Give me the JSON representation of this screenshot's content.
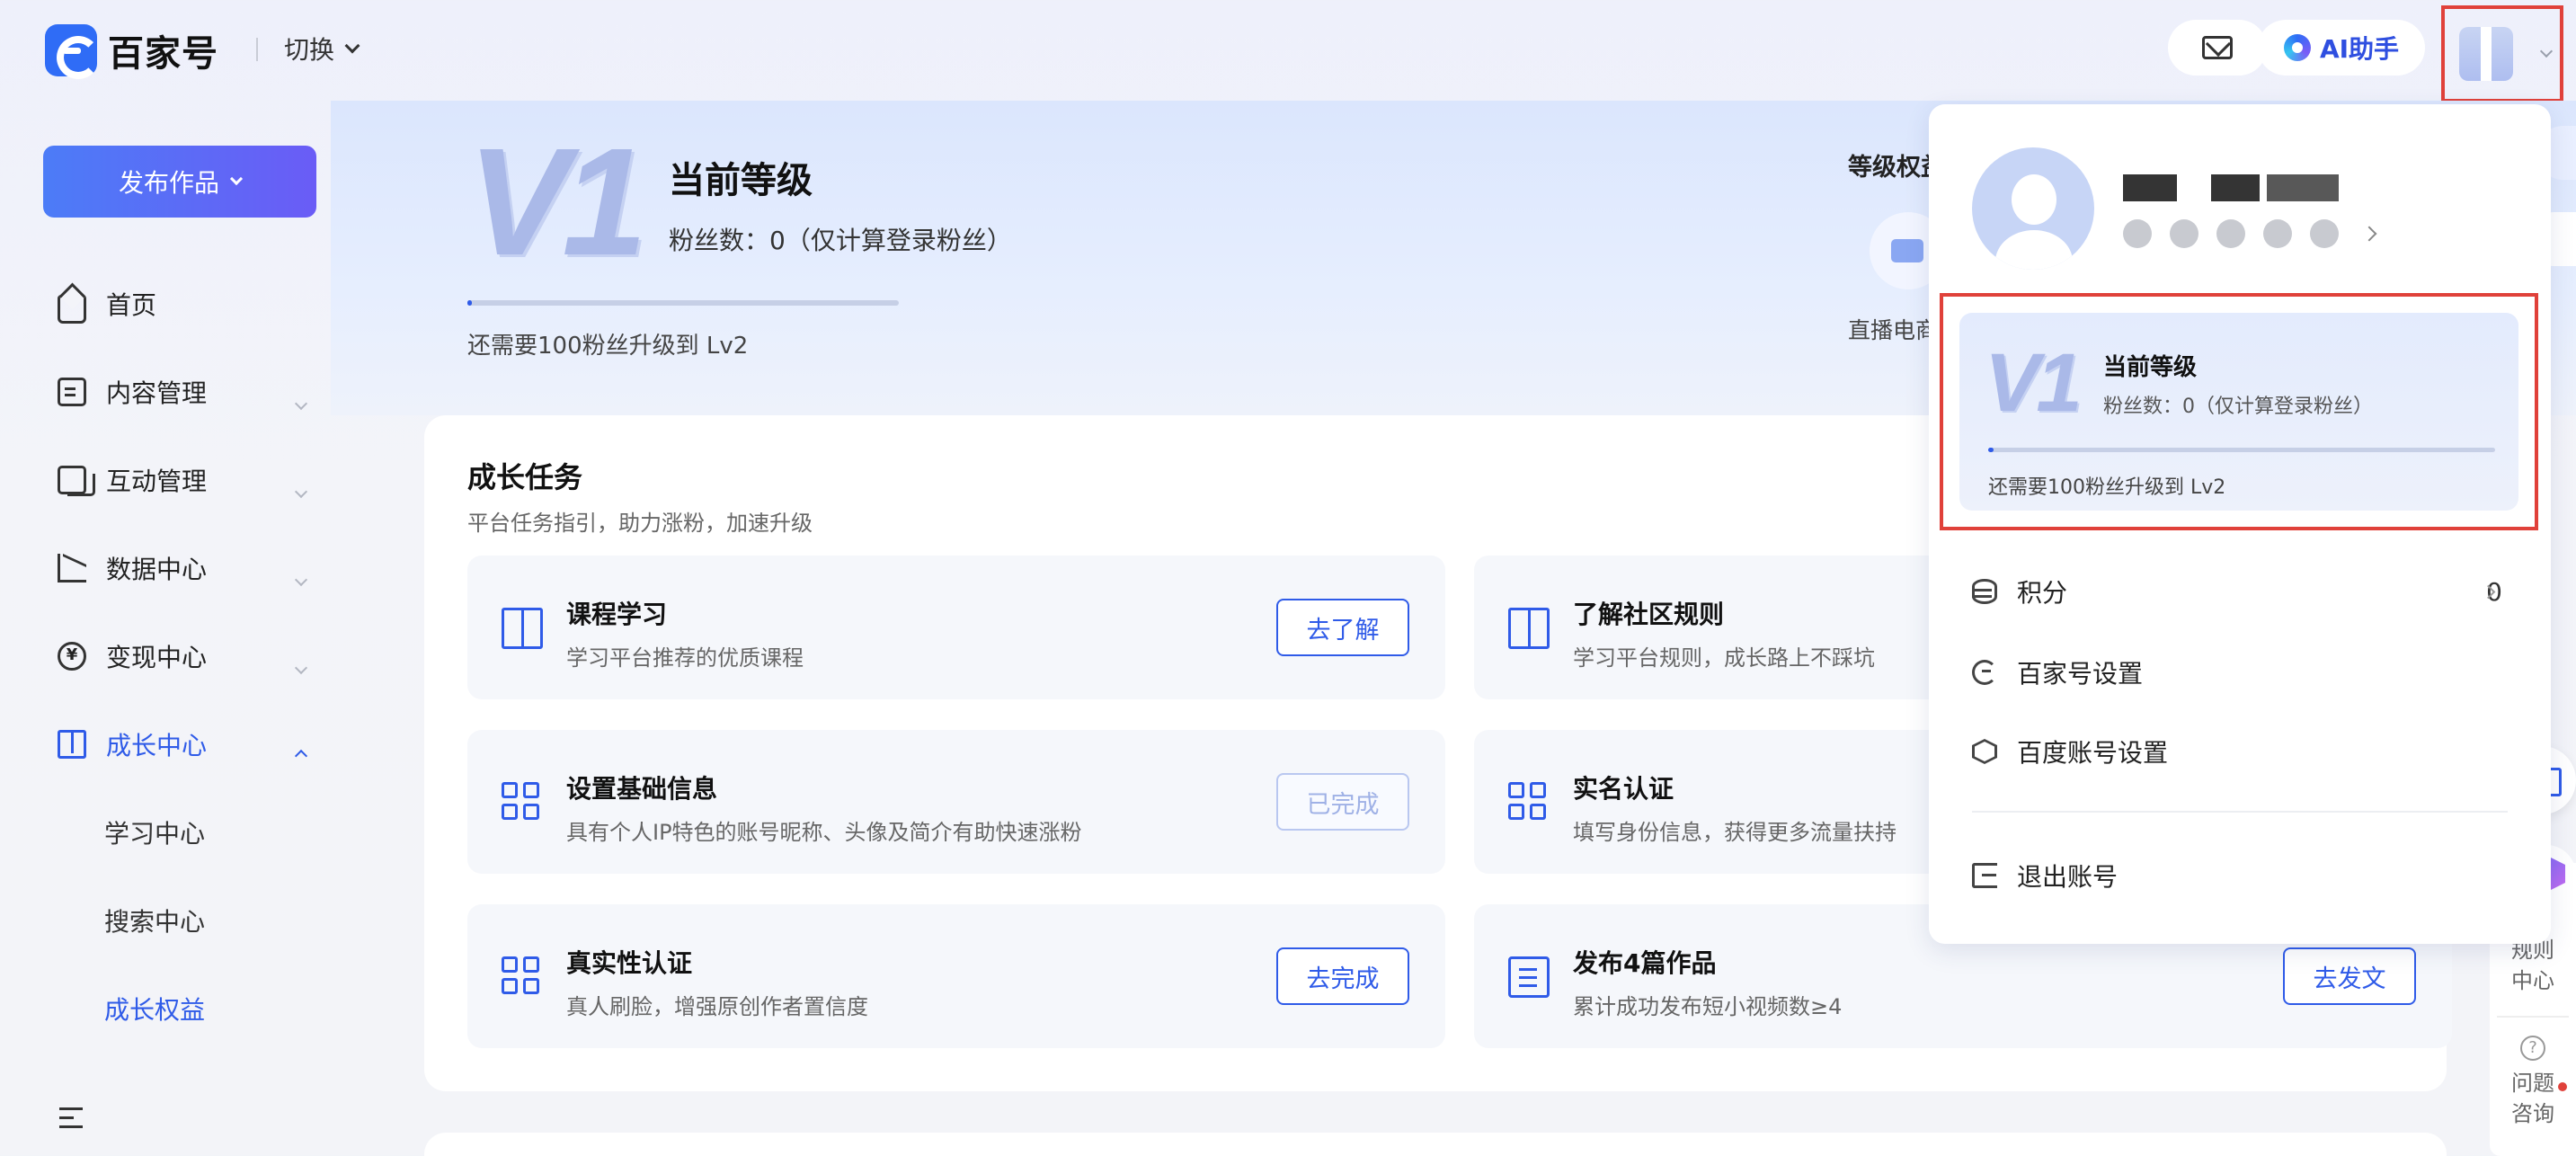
{
  "app": {
    "logo_text": "百家号",
    "switch_label": "切换"
  },
  "header": {
    "ai_label": "AI助手"
  },
  "sidebar": {
    "publish_label": "发布作品",
    "items": [
      {
        "label": "首页",
        "icon": "home-icon"
      },
      {
        "label": "内容管理",
        "icon": "document-icon"
      },
      {
        "label": "互动管理",
        "icon": "chat-icon"
      },
      {
        "label": "数据中心",
        "icon": "chart-icon"
      },
      {
        "label": "变现中心",
        "icon": "yen-icon"
      },
      {
        "label": "成长中心",
        "icon": "book-icon"
      }
    ],
    "sub_items": [
      "学习中心",
      "搜索中心",
      "成长权益"
    ]
  },
  "hero": {
    "level_badge": "V1",
    "title": "当前等级",
    "fans": "粉丝数：0（仅计算登录粉丝）",
    "need": "还需要100粉丝升级到 Lv2",
    "progress": 0.01,
    "rights_title": "等级权益",
    "rights_label": "直播电商"
  },
  "growth": {
    "title": "成长任务",
    "subtitle": "平台任务指引，助力涨粉，加速升级",
    "tasks": [
      {
        "name": "课程学习",
        "desc": "学习平台推荐的优质课程",
        "button": "去了解",
        "icon": "book-icon"
      },
      {
        "name": "了解社区规则",
        "desc": "学习平台规则，成长路上不踩坑",
        "button": "",
        "icon": "book-icon"
      },
      {
        "name": "设置基础信息",
        "desc": "具有个人IP特色的账号昵称、头像及简介有助快速涨粉",
        "button": "已完成",
        "icon": "grid-icon"
      },
      {
        "name": "实名认证",
        "desc": "填写身份信息，获得更多流量扶持",
        "button": "",
        "icon": "grid-icon"
      },
      {
        "name": "真实性认证",
        "desc": "真人刷脸，增强原创作者置信度",
        "button": "去完成",
        "icon": "grid-icon"
      },
      {
        "name": "发布4篇作品",
        "desc": "累计成功发布短小视频数≥4",
        "button": "去发文",
        "icon": "list-icon"
      }
    ]
  },
  "dropdown": {
    "level": {
      "badge": "V1",
      "title": "当前等级",
      "fans": "粉丝数：0（仅计算登录粉丝）",
      "need": "还需要100粉丝升级到 Lv2",
      "progress": 0.01
    },
    "points_label": "积分",
    "points_value": "0",
    "bjh_settings": "百家号设置",
    "baidu_settings": "百度账号设置",
    "logout": "退出账号"
  },
  "side_tools": {
    "rules": "规则中心",
    "help": "问题咨询"
  },
  "colors": {
    "accent": "#2f5be8",
    "highlight_border": "#e0413a"
  }
}
